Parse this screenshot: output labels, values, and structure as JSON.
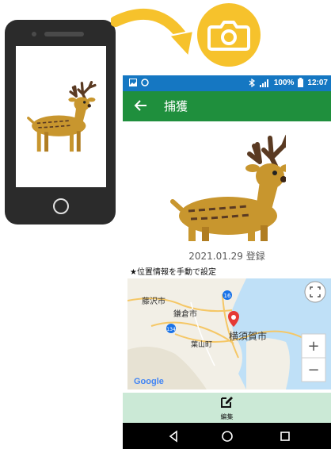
{
  "colors": {
    "status_bar": "#1577c2",
    "app_bar": "#1f8f3d",
    "bottom_bar": "#cbe9d6",
    "camera_badge": "#f6c22c",
    "arrow": "#f6c22c",
    "deer_body": "#c8962e",
    "map_water": "#bfe0f7",
    "map_land": "#f2efe6",
    "pin": "#e53935"
  },
  "status_bar": {
    "battery": "100%",
    "time": "12:07",
    "icons": [
      "image-notification-icon",
      "circle-notification-icon",
      "bluetooth-icon",
      "signal-4g-icon",
      "battery-icon"
    ]
  },
  "app_bar": {
    "back_icon": "arrow-left-icon",
    "title": "捕獲"
  },
  "record": {
    "date_text": "2021.01.29 登録"
  },
  "location": {
    "label": "★位置情報を手動で設定"
  },
  "map": {
    "labels": {
      "fujisawa": "藤沢市",
      "kamakura": "鎌倉市",
      "hayama": "葉山町",
      "yokosuka": "横須賀市",
      "route_16": "16",
      "route_134": "134",
      "attribution": "Google"
    },
    "controls": {
      "fullscreen": "fullscreen-icon",
      "zoom_in": "+",
      "zoom_out": "−"
    }
  },
  "bottom_bar": {
    "edit_label": "編集",
    "edit_icon": "edit-square-icon"
  },
  "navbar": {
    "back": "◁",
    "home": "○",
    "recents": "□"
  }
}
